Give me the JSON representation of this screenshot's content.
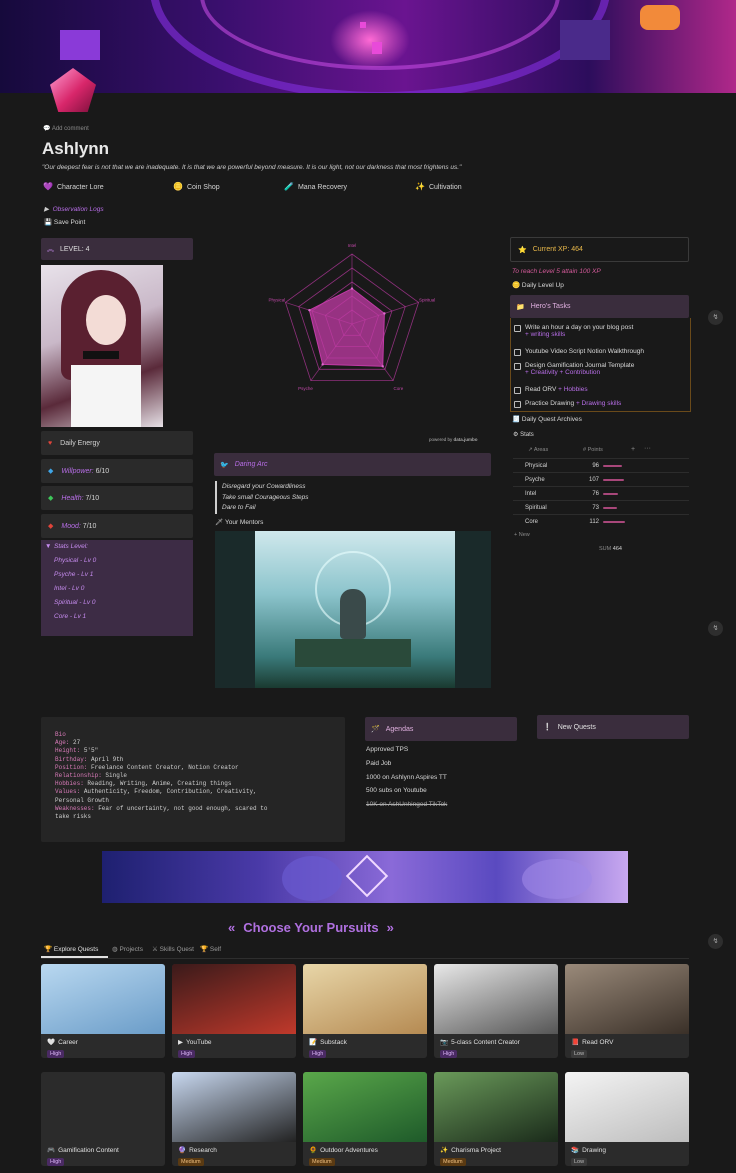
{
  "page": {
    "add_comment": "Add comment",
    "title": "Ashlynn",
    "quote": "\"Our deepest fear is not that we are inadequate. It is that we are powerful beyond measure. It is our light, not our darkness that most frightens us.\""
  },
  "nav": [
    {
      "icon": "heart-icon",
      "glyph": "💜",
      "label": "Character Lore"
    },
    {
      "icon": "coin-icon",
      "glyph": "🪙",
      "label": "Coin Shop"
    },
    {
      "icon": "potion-icon",
      "glyph": "🧪",
      "label": "Mana Recovery"
    },
    {
      "icon": "wand-icon",
      "glyph": "✨",
      "label": "Cultivation"
    }
  ],
  "toggles": {
    "observation": "Observation Logs",
    "save": "Save Point"
  },
  "level": {
    "label": "LEVEL: 4"
  },
  "stats": [
    {
      "icon": "heart-icon",
      "glyph": "♥",
      "color": "#e0443a",
      "label": "Daily Energy",
      "value": ""
    },
    {
      "icon": "diamond-blue-icon",
      "glyph": "◆",
      "color": "#3fa6e8",
      "label": "Willpower:",
      "value": " 6/10"
    },
    {
      "icon": "diamond-green-icon",
      "glyph": "◆",
      "color": "#3ec75a",
      "label": "Health:",
      "value": " 7/10"
    },
    {
      "icon": "diamond-red-icon",
      "glyph": "◆",
      "color": "#e0443a",
      "label": "Mood:",
      "value": " 7/10"
    }
  ],
  "stats_level": {
    "title": "Stats Level:",
    "items": [
      "Physical - Lv 0",
      "Psyche - Lv 1",
      "Intel - Lv 0",
      "Spiritual - Lv 0",
      "Core - Lv 1"
    ]
  },
  "radar": {
    "axes": [
      "Intel",
      "Spiritual",
      "Core",
      "Psyche",
      "Physical"
    ],
    "values": [
      76,
      73,
      112,
      107,
      96
    ],
    "max": 150,
    "credit": "powered by",
    "credit_brand": "data.jumbo",
    "color": "#c13ba6"
  },
  "arc": {
    "title": "Daring Arc",
    "lines": [
      "Disregard your Cowardliness",
      "Take small Courageous Steps",
      "Dare to Fail"
    ],
    "mentors": "Your Mentors"
  },
  "xp": {
    "label": "Current XP: 464",
    "hint": "To reach Level 5 attain 100 XP",
    "daily": "Daily Level Up"
  },
  "tasks": {
    "title": "Hero's Tasks",
    "items": [
      {
        "text": "Write an hour a day on your blog post",
        "tag": "+ writing skills"
      },
      {
        "text": "Youtube Video Script Notion Walkthrough",
        "tag": ""
      },
      {
        "text": "Design Gamification Journal Template",
        "tag": "+ Creativity + Contribution"
      },
      {
        "text": "Read ORV",
        "tag": "+ Hobbies"
      },
      {
        "text": "Practice Drawing",
        "tag": "+ Drawing skills"
      }
    ],
    "archives": "Daily Quest Archives"
  },
  "stats_table": {
    "title": "Stats",
    "col_areas": "Areas",
    "col_points": "Points",
    "rows": [
      {
        "area": "Physical",
        "points": 96
      },
      {
        "area": "Psyche",
        "points": 107
      },
      {
        "area": "Intel",
        "points": 76
      },
      {
        "area": "Spiritual",
        "points": 73
      },
      {
        "area": "Core",
        "points": 112
      }
    ],
    "new": "+ New",
    "sum_label": "SUM",
    "sum": "464"
  },
  "bio": {
    "title": "Bio",
    "lines": [
      {
        "k": "Age:",
        "v": " 27"
      },
      {
        "k": "Height:",
        "v": " 5'5\""
      },
      {
        "k": "Birthday:",
        "v": " April 9th"
      },
      {
        "k": "Position:",
        "v": " Freelance Content Creator, Notion Creator"
      },
      {
        "k": "Relationship:",
        "v": " Single"
      },
      {
        "k": "Hobbies:",
        "v": " Reading, Writing, Anime, Creating things"
      },
      {
        "k": "Values:",
        "v": " Authenticity, Freedom, Contribution, Creativity,"
      },
      {
        "k": "",
        "v": "Personal Growth"
      },
      {
        "k": "Weaknesses:",
        "v": " Fear of uncertainty, not good enough, scared to"
      },
      {
        "k": "",
        "v": "take risks"
      }
    ]
  },
  "agendas": {
    "title": "Agendas",
    "items": [
      "Approved TPS",
      "Paid Job",
      "1000 on Ashlynn Aspires TT",
      "500 subs on Youtube",
      "10K on AshUnhinged TikTok"
    ],
    "struck_index": 4
  },
  "new_quests": "New Quests",
  "pursuits": {
    "title": "Choose Your Pursuits",
    "left": "«",
    "right": "»"
  },
  "tabs": [
    "Explore Quests",
    "Projects",
    "Skills Quest",
    "Self"
  ],
  "cards": [
    {
      "title": "Career",
      "tag": "High",
      "cls": "high",
      "glyph": "🤍",
      "c1": "#b9d8f0",
      "c2": "#6a9cc8"
    },
    {
      "title": "YouTube",
      "tag": "High",
      "cls": "high",
      "glyph": "▶",
      "c1": "#3a1a1a",
      "c2": "#c0392b"
    },
    {
      "title": "Substack",
      "tag": "High",
      "cls": "high",
      "glyph": "📝",
      "c1": "#e8d6a8",
      "c2": "#b58a52"
    },
    {
      "title": "5-class Content Creator",
      "tag": "High",
      "cls": "high",
      "glyph": "📷",
      "c1": "#e8e8e8",
      "c2": "#555"
    },
    {
      "title": "Read ORV",
      "tag": "Low",
      "cls": "low",
      "glyph": "📕",
      "c1": "#9a8a7a",
      "c2": "#3a3028"
    },
    {
      "title": "Gamification Content",
      "tag": "High",
      "cls": "high",
      "glyph": "🎮",
      "c1": "#2b2b2b",
      "c2": "#2b2b2b"
    },
    {
      "title": "Research",
      "tag": "Medium",
      "cls": "med",
      "glyph": "🔮",
      "c1": "#c8d8f0",
      "c2": "#222"
    },
    {
      "title": "Outdoor Adventures",
      "tag": "Medium",
      "cls": "med",
      "glyph": "🌻",
      "c1": "#5aa84a",
      "c2": "#1e5a2a"
    },
    {
      "title": "Charisma Project",
      "tag": "Medium",
      "cls": "med",
      "glyph": "✨",
      "c1": "#6a9a5a",
      "c2": "#1a2a1a"
    },
    {
      "title": "Drawing",
      "tag": "Low",
      "cls": "low",
      "glyph": "📚",
      "c1": "#f4f4f4",
      "c2": "#bdbdbd"
    }
  ]
}
